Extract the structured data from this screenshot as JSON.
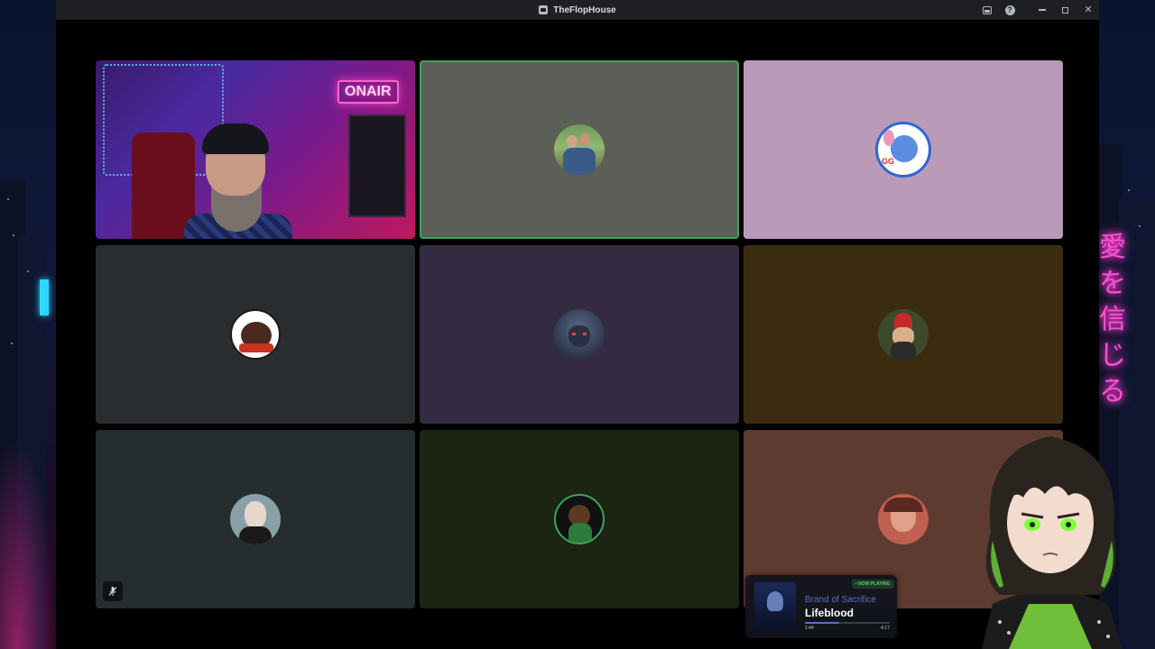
{
  "window": {
    "title": "TheFlopHouse",
    "controls": [
      "inbox-icon",
      "help-icon",
      "minimize-icon",
      "maximize-icon",
      "close-icon"
    ],
    "help_glyph": "?",
    "close_glyph": "✕"
  },
  "backdrop": {
    "sign_text": "愛を信じる"
  },
  "grid": {
    "tiles": [
      {
        "kind": "video",
        "background": "#3b2a6a",
        "speaking": false
      },
      {
        "kind": "avatar",
        "background": "#5c5e58",
        "speaking": true
      },
      {
        "kind": "avatar",
        "background": "#b99ab9",
        "speaking": false
      },
      {
        "kind": "avatar",
        "background": "#2a2d2f",
        "speaking": false
      },
      {
        "kind": "avatar",
        "background": "#342b42",
        "speaking": false
      },
      {
        "kind": "avatar",
        "background": "#3b2c10",
        "speaking": false
      },
      {
        "kind": "avatar",
        "background": "#252d2e",
        "speaking": false,
        "muted_icon": true
      },
      {
        "kind": "avatar",
        "background": "#1c2414",
        "speaking": false
      },
      {
        "kind": "avatar",
        "background": "#5e3b30",
        "speaking": false
      }
    ],
    "speaking_color": "#3ba55d"
  },
  "now_playing": {
    "badge": "• NOW PLAYING",
    "artist": "Brand of Sacrifice",
    "title": "Lifeblood",
    "elapsed": "1:44",
    "duration": "4:17",
    "progress": 0.4
  }
}
